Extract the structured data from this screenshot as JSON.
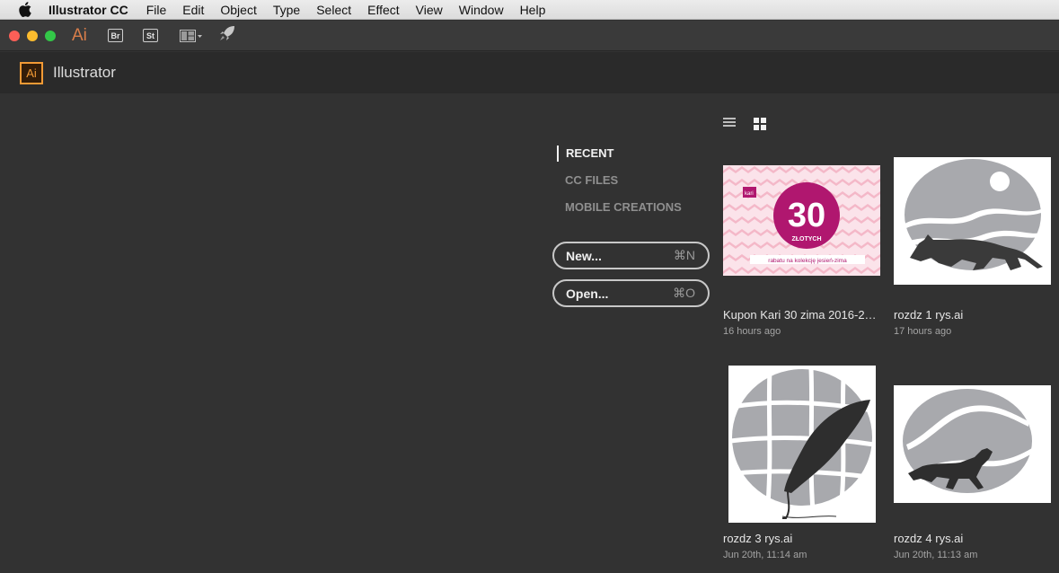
{
  "menubar": {
    "app_name": "Illustrator CC",
    "items": [
      "File",
      "Edit",
      "Object",
      "Type",
      "Select",
      "Effect",
      "View",
      "Window",
      "Help"
    ]
  },
  "toolbar": {
    "ai_label": "Ai",
    "bridge_label": "Br",
    "stock_label": "St"
  },
  "header": {
    "logo_label": "Ai",
    "title": "Illustrator"
  },
  "nav": {
    "recent": "RECENT",
    "cc_files": "CC FILES",
    "mobile_creations": "MOBILE CREATIONS"
  },
  "actions": {
    "new_label": "New...",
    "new_shortcut": "⌘N",
    "open_label": "Open...",
    "open_shortcut": "⌘O"
  },
  "files": [
    {
      "name": "Kupon Kari 30 zima 2016-201...",
      "time": "16 hours ago",
      "thumb": {
        "brand": "kari",
        "number": "30",
        "unit": "ZŁOTYCH",
        "caption": "rabatu na kolekcję jesień-zima"
      }
    },
    {
      "name": "rozdz 1 rys.ai",
      "time": "17 hours ago"
    },
    {
      "name": "rozdz 3 rys.ai",
      "time": "Jun 20th, 11:14 am"
    },
    {
      "name": "rozdz 4 rys.ai",
      "time": "Jun 20th, 11:13 am"
    }
  ],
  "colors": {
    "background": "#323232",
    "accent_orange": "#f29a35",
    "coupon_magenta": "#b0176f",
    "coupon_pink": "#f4b8c8"
  }
}
